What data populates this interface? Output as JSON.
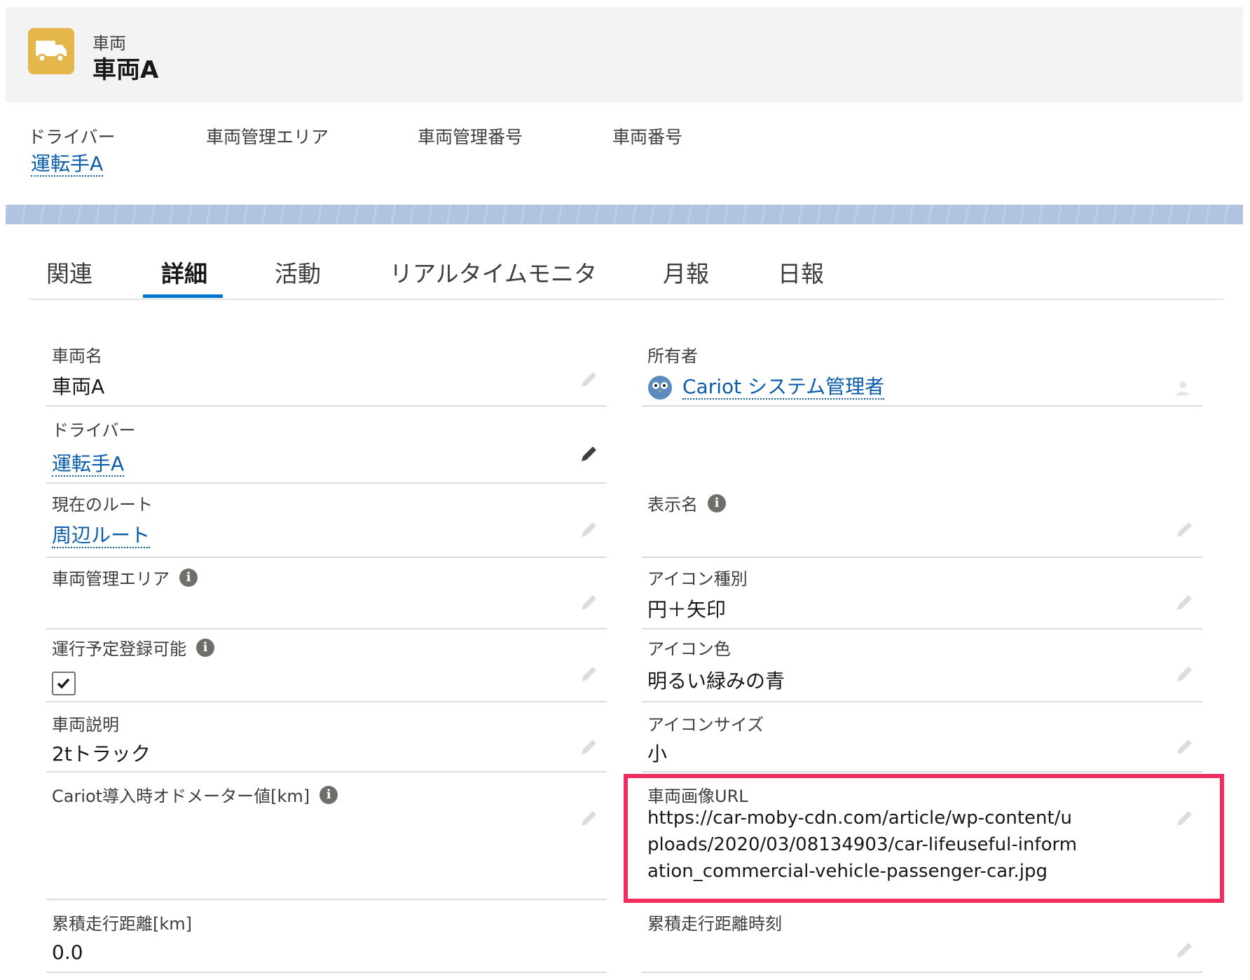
{
  "header": {
    "object_type": "車両",
    "record_name": "車両A",
    "icon": "truck-icon",
    "icon_color": "#e4b64b"
  },
  "highlights": [
    {
      "label": "ドライバー",
      "value": "運転手A"
    },
    {
      "label": "車両管理エリア",
      "value": ""
    },
    {
      "label": "車両管理番号",
      "value": ""
    },
    {
      "label": "車両番号",
      "value": ""
    }
  ],
  "tabs": [
    {
      "label": "関連"
    },
    {
      "label": "詳細",
      "active": true
    },
    {
      "label": "活動"
    },
    {
      "label": "リアルタイムモニタ"
    },
    {
      "label": "月報"
    },
    {
      "label": "日報"
    }
  ],
  "fields": {
    "vehicle_name": {
      "label": "車両名",
      "value": "車両A"
    },
    "owner": {
      "label": "所有者",
      "value": "Cariot システム管理者"
    },
    "driver": {
      "label": "ドライバー",
      "value": "運転手A"
    },
    "current_route": {
      "label": "現在のルート",
      "value": "周辺ルート"
    },
    "display_name": {
      "label": "表示名",
      "value": ""
    },
    "management_area": {
      "label": "車両管理エリア",
      "value": ""
    },
    "icon_type": {
      "label": "アイコン種別",
      "value": "円＋矢印"
    },
    "schedule_registrable": {
      "label": "運行予定登録可能",
      "checked": true
    },
    "icon_color": {
      "label": "アイコン色",
      "value": "明るい緑みの青"
    },
    "description": {
      "label": "車両説明",
      "value": "2tトラック"
    },
    "icon_size": {
      "label": "アイコンサイズ",
      "value": "小"
    },
    "odometer": {
      "label": "Cariot導入時オドメーター値[km]",
      "value": ""
    },
    "image_url": {
      "label": "車両画像URL",
      "value": "https://car-moby-cdn.com/article/wp-content/uploads/2020/03/08134903/car-lifeuseful-information_commercial-vehicle-passenger-car.jpg"
    },
    "total_distance": {
      "label": "累積走行距離[km]",
      "value": "0.0"
    },
    "total_distance_time": {
      "label": "累積走行距離時刻",
      "value": ""
    }
  },
  "colors": {
    "link": "#0b5cab",
    "tab_active": "#0176d3",
    "highlight_border": "#ef2d5e",
    "band": "#b0c4df"
  }
}
